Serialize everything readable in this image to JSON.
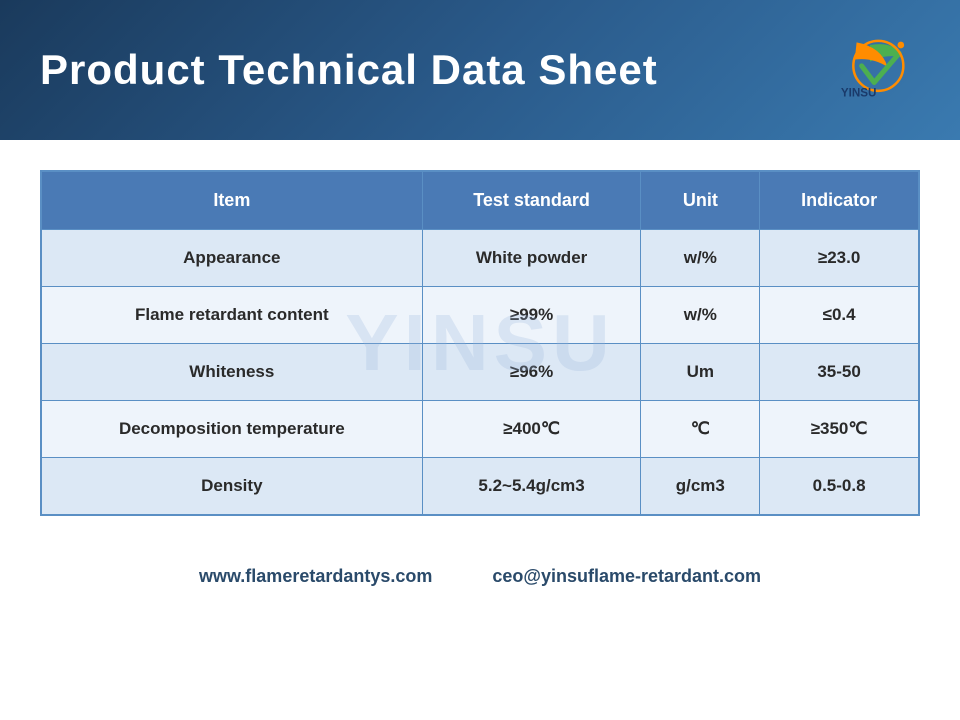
{
  "header": {
    "title": "Product Technical Data Sheet",
    "logo_text": "YINSU"
  },
  "table": {
    "headers": [
      "Item",
      "Test standard",
      "Unit",
      "Indicator"
    ],
    "rows": [
      {
        "item": "Appearance",
        "test_standard": "White powder",
        "unit": "w/%",
        "indicator": "≥23.0",
        "style": "light"
      },
      {
        "item": "Flame retardant content",
        "test_standard": "≥99%",
        "unit": "w/%",
        "indicator": "≤0.4",
        "style": "white"
      },
      {
        "item": "Whiteness",
        "test_standard": "≥96%",
        "unit": "Um",
        "indicator": "35-50",
        "style": "light"
      },
      {
        "item": "Decomposition temperature",
        "test_standard": "≥400℃",
        "unit": "℃",
        "indicator": "≥350℃",
        "style": "white"
      },
      {
        "item": "Density",
        "test_standard": "5.2~5.4g/cm3",
        "unit": "g/cm3",
        "indicator": "0.5-0.8",
        "style": "light"
      }
    ],
    "watermark": "YINSU"
  },
  "footer": {
    "website": "www.flameretardantys.com",
    "email": "ceo@yinsuflame-retardant.com"
  }
}
